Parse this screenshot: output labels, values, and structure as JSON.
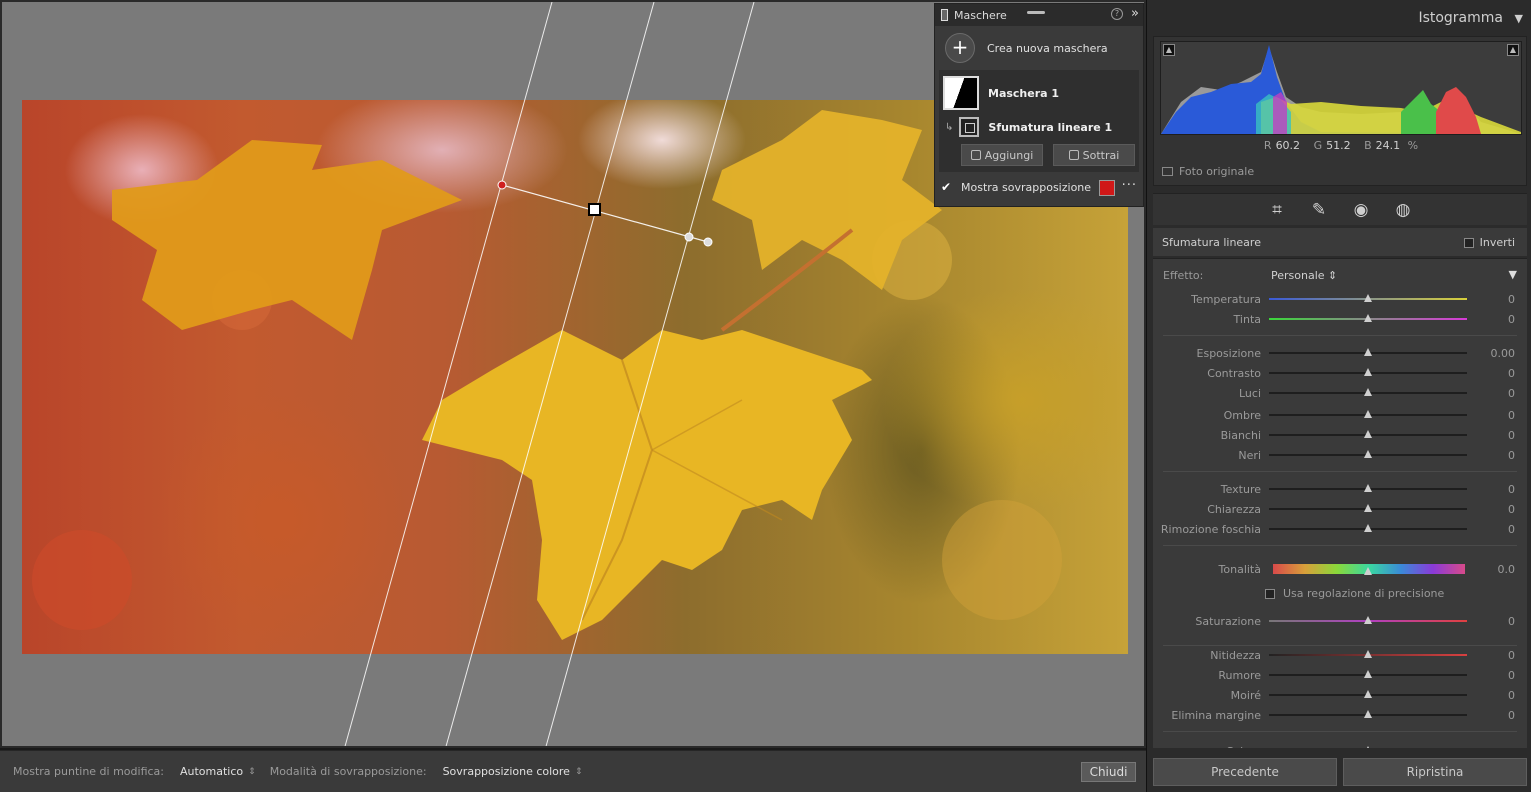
{
  "masks_panel": {
    "title": "Maschere",
    "create_label": "Crea nuova maschera",
    "mask_name": "Maschera 1",
    "component_name": "Sfumatura lineare 1",
    "add_label": "Aggiungi",
    "subtract_label": "Sottrai",
    "show_overlay_label": "Mostra sovrapposizione",
    "overlay_color": "#d01818"
  },
  "toolbar": {
    "pins_label": "Mostra puntine di modifica:",
    "pins_value": "Automatico",
    "overlay_mode_label": "Modalità di sovrapposizione:",
    "overlay_mode_value": "Sovrapposizione colore",
    "close_label": "Chiudi"
  },
  "histogram": {
    "title": "Istogramma",
    "r_label": "R",
    "r_value": "60.2",
    "g_label": "G",
    "g_value": "51.2",
    "b_label": "B",
    "b_value": "24.1",
    "unit": "%",
    "original_label": "Foto originale"
  },
  "tools": [
    "crop-icon",
    "healing-icon",
    "redeye-icon",
    "masking-icon"
  ],
  "gradient_panel": {
    "title": "Sfumatura lineare",
    "invert_label": "Inverti",
    "effect_label": "Effetto:",
    "effect_value": "Personale"
  },
  "sliders": [
    {
      "label": "Temperatura",
      "value": "0",
      "pos": 0.5,
      "gradient": "linear-gradient(90deg,#3a5ad8,#d8d03a)"
    },
    {
      "label": "Tinta",
      "value": "0",
      "pos": 0.5,
      "gradient": "linear-gradient(90deg,#3ad83a,#d83ad8)"
    },
    {
      "label": "Esposizione",
      "value": "0.00",
      "pos": 0.5
    },
    {
      "label": "Contrasto",
      "value": "0",
      "pos": 0.5
    },
    {
      "label": "Luci",
      "value": "0",
      "pos": 0.5
    },
    {
      "label": "Ombre",
      "value": "0",
      "pos": 0.5
    },
    {
      "label": "Bianchi",
      "value": "0",
      "pos": 0.5
    },
    {
      "label": "Neri",
      "value": "0",
      "pos": 0.5
    },
    {
      "label": "Texture",
      "value": "0",
      "pos": 0.5
    },
    {
      "label": "Chiarezza",
      "value": "0",
      "pos": 0.5
    },
    {
      "label": "Rimozione foschia",
      "value": "0",
      "pos": 0.5
    },
    {
      "label": "Tonalità",
      "value": "0.0",
      "pos": 0.5,
      "gradient": "linear-gradient(90deg,#d84a4a,#d8a03a,#8ad83a,#3ad8a0,#3a8ad8,#8a3ad8,#d84a8a)"
    },
    {
      "label": "Saturazione",
      "value": "0",
      "pos": 0.5,
      "gradient": "linear-gradient(90deg,#777,#b040c0,#e04040)"
    },
    {
      "label": "Nitidezza",
      "value": "0",
      "pos": 0.5,
      "gradient": "linear-gradient(90deg,#222,#d84040)"
    },
    {
      "label": "Rumore",
      "value": "0",
      "pos": 0.5
    },
    {
      "label": "Moiré",
      "value": "0",
      "pos": 0.5
    },
    {
      "label": "Elimina margine",
      "value": "0",
      "pos": 0.5
    },
    {
      "label": "Colore",
      "value": "",
      "pos": 0.5
    }
  ],
  "precision_label": "Usa regolazione di precisione",
  "bottom": {
    "previous_label": "Precedente",
    "reset_label": "Ripristina"
  }
}
